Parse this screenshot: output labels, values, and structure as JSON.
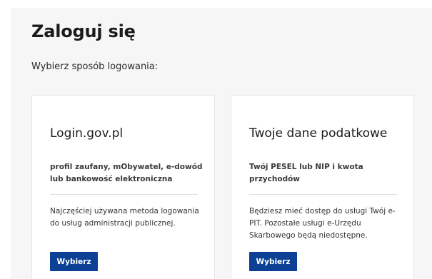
{
  "page": {
    "title": "Zaloguj się",
    "subtitle": "Wybierz sposób logowania:"
  },
  "colors": {
    "accent": "#0b4094",
    "panel_background": "#f6f6f6",
    "card_background": "#ffffff"
  },
  "cards": [
    {
      "title": "Login.gov.pl",
      "description": "profil zaufany, mObywatel, e-dowód lub bankowość elektroniczna",
      "info": "Najczęściej używana metoda logowania do usług administracji publicznej.",
      "button_label": "Wybierz"
    },
    {
      "title": "Twoje dane podatkowe",
      "description": "Twój PESEL lub NIP i kwota przychodów",
      "info": "Będziesz mieć dostęp do usługi Twój e-PIT. Pozostałe usługi e-Urzędu Skarbowego będą niedostępne.",
      "button_label": "Wybierz"
    }
  ]
}
